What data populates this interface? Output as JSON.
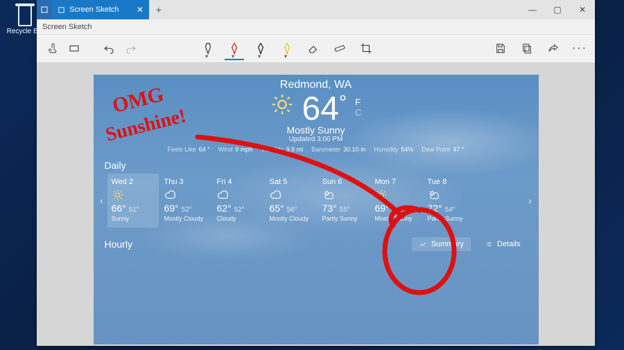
{
  "desktop": {
    "recycle_label": "Recycle Bin"
  },
  "window": {
    "tab_title": "Screen Sketch",
    "breadcrumb": "Screen Sketch",
    "controls": {
      "minimize": "—",
      "maximize": "▢",
      "close": "✕"
    },
    "newtab": "+"
  },
  "toolbar": {
    "touch_writing": "touch-writing",
    "crop_mode": "crop-mode",
    "undo": "undo",
    "redo": "redo",
    "pen_ball": "ballpoint-pen",
    "pen_red": "pen-red",
    "pen_black": "pen-black",
    "highlighter": "highlighter",
    "eraser": "eraser",
    "ruler": "ruler",
    "crop": "crop",
    "save": "save",
    "copy": "copy",
    "share": "share",
    "more": "more"
  },
  "weather": {
    "location": "Redmond, WA",
    "temp": "64",
    "deg": "°",
    "unit_f": "F",
    "unit_c": "C",
    "condition": "Mostly Sunny",
    "updated": "Updated     3:00 PM",
    "stats": {
      "feels_label": "Feels Like",
      "feels_val": "64 °",
      "wind_label": "Wind",
      "wind_val": "9 mph",
      "vis_label": "Visibility",
      "vis_val": "9.9 mi",
      "baro_label": "Barometer",
      "baro_val": "30.10 in",
      "hum_label": "Humidity",
      "hum_val": "54%",
      "dew_label": "Dew Point",
      "dew_val": "47 °"
    },
    "daily_title": "Daily",
    "hourly_title": "Hourly",
    "nav_prev": "‹",
    "nav_next": "›",
    "days": [
      {
        "name": "Wed 2",
        "icon": "sun",
        "hi": "66°",
        "lo": "51°",
        "cond": "Sunny",
        "sel": true
      },
      {
        "name": "Thu 3",
        "icon": "cloud",
        "hi": "69°",
        "lo": "52°",
        "cond": "Mostly Cloudy"
      },
      {
        "name": "Fri 4",
        "icon": "cloud",
        "hi": "62°",
        "lo": "52°",
        "cond": "Cloudy"
      },
      {
        "name": "Sat 5",
        "icon": "cloud",
        "hi": "65°",
        "lo": "56°",
        "cond": "Mostly Cloudy"
      },
      {
        "name": "Sun 6",
        "icon": "partly",
        "hi": "73°",
        "lo": "55°",
        "cond": "Partly Sunny"
      },
      {
        "name": "Mon 7",
        "icon": "sun",
        "hi": "69°",
        "lo": "52°",
        "cond": "Mostly Sunny"
      },
      {
        "name": "Tue 8",
        "icon": "partly",
        "hi": "72°",
        "lo": "54°",
        "cond": "Partly Sunny"
      }
    ],
    "summary_btn": "Summary",
    "details_btn": "Details"
  },
  "annotations": {
    "text1": "OMG",
    "text2": "Sunshine!"
  }
}
